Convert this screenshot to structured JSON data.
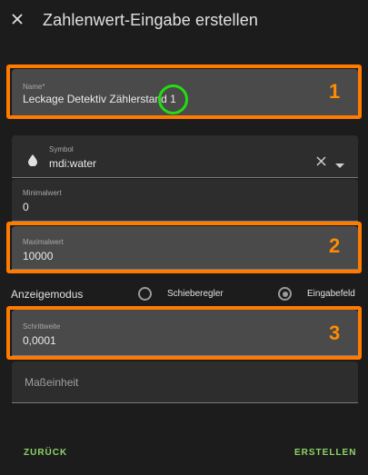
{
  "header": {
    "title": "Zahlenwert-Eingabe erstellen",
    "close_icon": "close-icon"
  },
  "fields": {
    "name": {
      "label": "Name*",
      "value": "Leckage Detektiv Zählerstand 1"
    },
    "symbol": {
      "label": "Symbol",
      "value": "mdi:water",
      "icon": "water-drop-icon"
    },
    "min": {
      "label": "Minimalwert",
      "value": "0"
    },
    "max": {
      "label": "Maximalwert",
      "value": "10000"
    },
    "step": {
      "label": "Schrittweite",
      "value": "0,0001"
    },
    "unit": {
      "placeholder": "Maßeinheit"
    }
  },
  "display_mode": {
    "label": "Anzeigemodus",
    "options": [
      {
        "label": "Schieberegler",
        "selected": false
      },
      {
        "label": "Eingabefeld",
        "selected": true
      }
    ]
  },
  "annotations": [
    "1",
    "2",
    "3"
  ],
  "actions": {
    "back": "ZURÜCK",
    "create": "ERSTELLEN"
  },
  "colors": {
    "background": "#1c1c1c",
    "field": "#2d2d2d",
    "field_highlighted": "#4a4a4a",
    "accent_text": "#8fd468",
    "annotation": "#ff7a00",
    "cursor_ring": "#22dd11"
  }
}
